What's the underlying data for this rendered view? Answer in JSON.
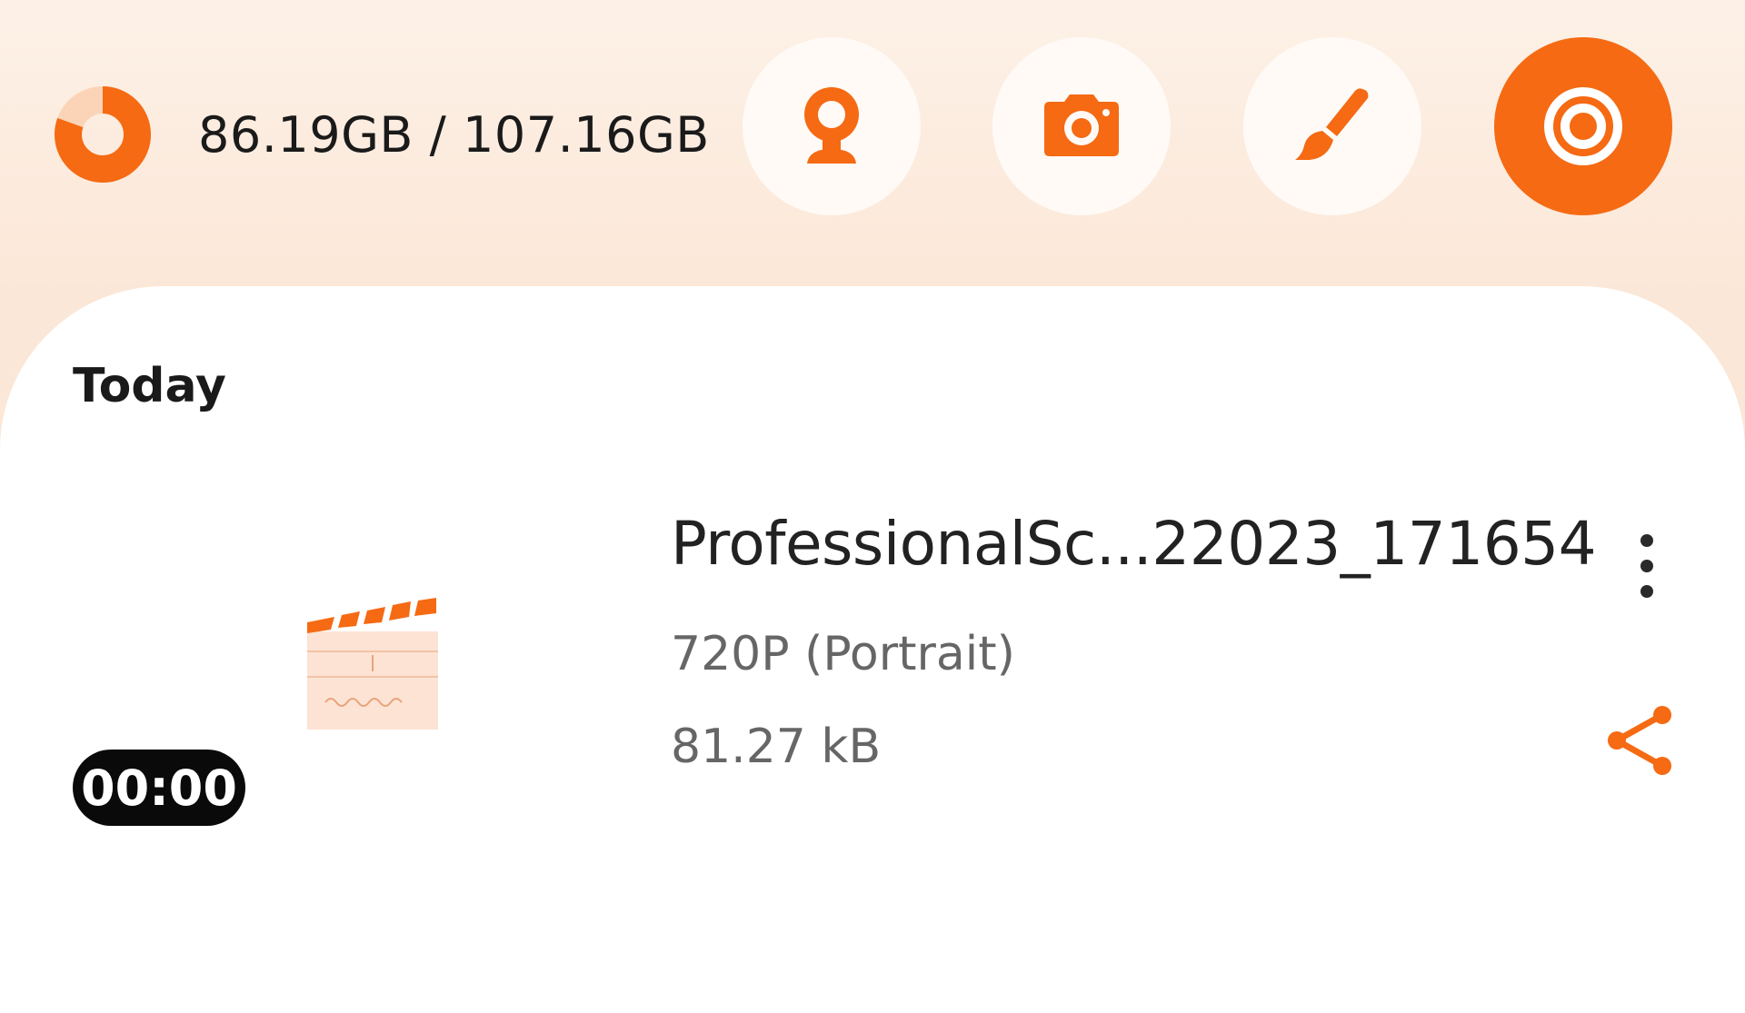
{
  "storage": {
    "text": "86.19GB / 107.16GB",
    "used_fraction": 0.8043
  },
  "toolbar": {
    "buttons": [
      {
        "name": "webcam",
        "icon": "webcam-icon",
        "active": false
      },
      {
        "name": "screenshot",
        "icon": "camera-icon",
        "active": false
      },
      {
        "name": "brush",
        "icon": "brush-icon",
        "active": false
      },
      {
        "name": "record",
        "icon": "record-icon",
        "active": true
      }
    ]
  },
  "colors": {
    "accent": "#f56a13",
    "accent_light": "#fbd4b8"
  },
  "section": {
    "label": "Today"
  },
  "recordings": [
    {
      "title": "ProfessionalSc...22023_171654",
      "resolution": "720P (Portrait)",
      "size": "81.27 kB",
      "duration": "00:00",
      "thumbnail_icon": "clapperboard-icon"
    }
  ]
}
